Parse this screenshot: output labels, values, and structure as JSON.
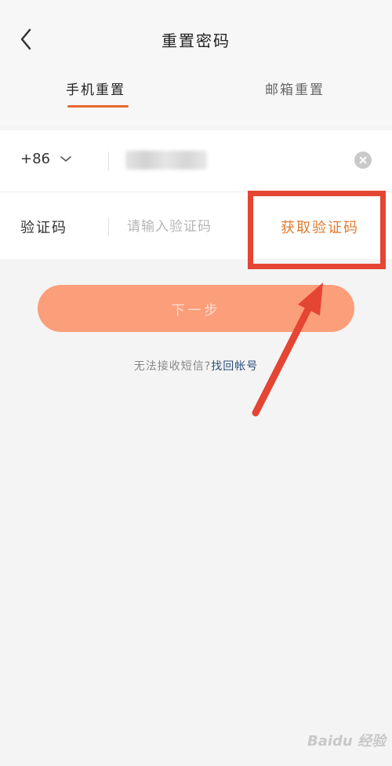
{
  "header": {
    "title": "重置密码",
    "back_icon": "chevron-left-icon"
  },
  "tabs": [
    {
      "label": "手机重置",
      "active": true
    },
    {
      "label": "邮箱重置",
      "active": false
    }
  ],
  "form": {
    "country_code": "+86",
    "country_code_icon": "chevron-down-icon",
    "phone_value": "",
    "clear_icon": "clear-icon",
    "code_label": "验证码",
    "code_placeholder": "请输入验证码",
    "get_code_label": "获取验证码"
  },
  "next_button": {
    "label": "下一步"
  },
  "help": {
    "text": "无法接收短信?",
    "link": "找回帐号"
  },
  "watermark": "Baidu 经验",
  "colors": {
    "accent": "#e8672f",
    "get_code_text": "#e07a2e",
    "next_button_bg": "#fb9e7a",
    "annotation_red": "#e54533",
    "help_link": "#2e4f7c"
  }
}
